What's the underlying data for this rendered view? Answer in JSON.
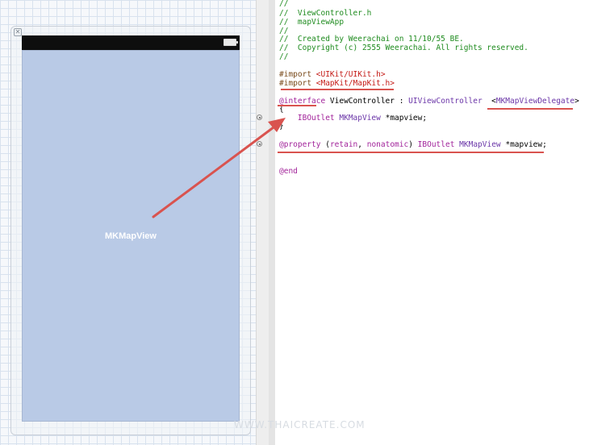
{
  "canvas": {
    "map_view_label": "MKMapView",
    "scene_close_glyph": "✕"
  },
  "code": {
    "comment_lines": [
      "//",
      "//  ViewController.h",
      "//  mapViewApp",
      "//",
      "//  Created by Weerachai on 11/10/55 BE.",
      "//  Copyright (c) 2555 Weerachai. All rights reserved.",
      "//"
    ],
    "import_uikit_directive": "#import ",
    "import_uikit_path": "<UIKit/UIKit.h>",
    "import_mapkit_directive": "#import ",
    "import_mapkit_path": "<MapKit/MapKit.h>",
    "interface_keyword": "@interface",
    "interface_rest": " ViewController : ",
    "superclass": "UIViewController",
    "protocol_open": "  <",
    "protocol_name": "MKMapViewDelegate",
    "protocol_close": ">",
    "brace_open": "{",
    "ivar_indent": "    ",
    "ivar_outlet": "IBOutlet",
    "ivar_space": " ",
    "ivar_type": "MKMapView",
    "ivar_name": " *mapview;",
    "brace_close": "}",
    "property_keyword": "@property",
    "property_paren_open": " (",
    "property_attr_retain": "retain",
    "property_comma": ", ",
    "property_attr_nonatomic": "nonatomic",
    "property_paren_close": ") ",
    "property_outlet": "IBOutlet",
    "property_space": " ",
    "property_type": "MKMapView",
    "property_name": " *mapview;",
    "end_keyword": "@end"
  },
  "watermark": "WWW.THAICREATE.COM",
  "colors": {
    "map_view_fill": "#b9cae6",
    "comment": "#1e8b1e",
    "string": "#c41a16",
    "keyword": "#a2239a",
    "annotation": "#d9534f"
  },
  "icons": [
    "scene-close-icon",
    "battery-icon",
    "outlet-connector-icon",
    "annotation-arrow"
  ]
}
